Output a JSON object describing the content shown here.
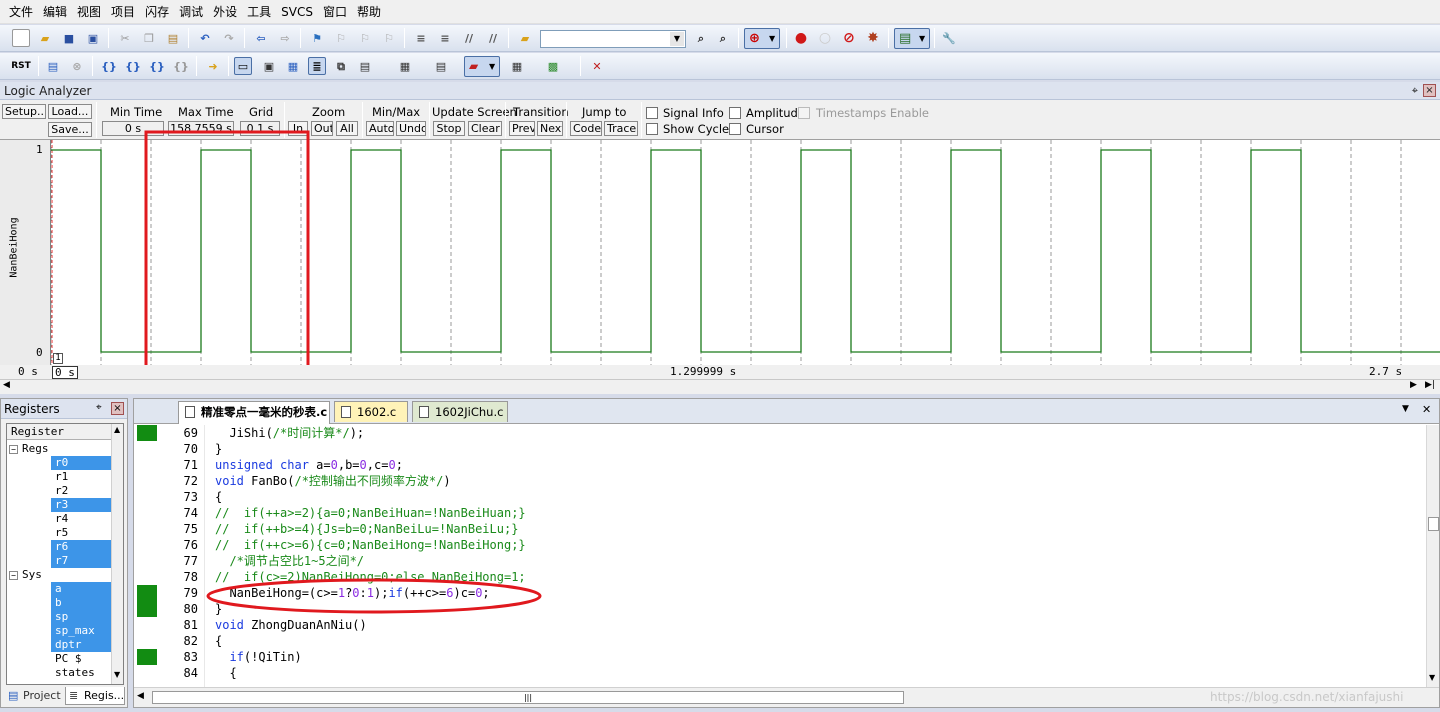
{
  "menu": [
    "文件",
    "编辑",
    "视图",
    "项目",
    "闪存",
    "调试",
    "外设",
    "工具",
    "SVCS",
    "窗口",
    "帮助"
  ],
  "toolbar1": {
    "combo_value": ""
  },
  "toolbar2": {
    "rst_label": "RST"
  },
  "logic_analyzer": {
    "title": "Logic Analyzer",
    "pin_label": "⌖",
    "close_label": "×",
    "setup_label": "Setup...",
    "load_label": "Load...",
    "save_label": "Save...",
    "min_time_label": "Min Time",
    "min_time_value": "0 s",
    "max_time_label": "Max Time",
    "max_time_value": "158.7559 s",
    "grid_label": "Grid",
    "grid_value": "0.1 s",
    "zoom_label": "Zoom",
    "zoom_in": "In",
    "zoom_out": "Out",
    "zoom_all": "All",
    "minmax_label": "Min/Max",
    "minmax_auto": "Auto",
    "minmax_undo": "Undo",
    "update_label": "Update Screen",
    "update_stop": "Stop",
    "update_clear": "Clear",
    "transition_label": "Transition",
    "transition_prev": "Prev",
    "transition_next": "Next",
    "jump_label": "Jump to",
    "jump_code": "Code",
    "jump_trace": "Trace",
    "signal_info": "Signal Info",
    "amplitude": "Amplitude",
    "timestamps": "Timestamps Enable",
    "show_cycles": "Show Cycles",
    "cursor": "Cursor",
    "signal_name": "NanBeiHong",
    "y_high": "1",
    "y_low": "0",
    "marker": "1",
    "time_start": "0 s",
    "time_cursor": "0 s",
    "time_mid": "1.299999 s",
    "time_end": "2.7 s",
    "colors": {
      "wave": "#1a7a1a",
      "grid": "#808080",
      "highlight_box": "#e0191e"
    },
    "waveform": {
      "t_range_s": [
        0,
        2.7
      ],
      "rises_s": [
        0.0,
        0.3,
        0.6,
        0.9,
        1.2,
        1.5,
        1.8,
        2.1,
        2.4
      ],
      "high_duration_s": 0.1
    }
  },
  "registers": {
    "title": "Registers",
    "header": "Register",
    "groups": [
      {
        "name": "Regs",
        "items": [
          {
            "name": "r0",
            "hl": true
          },
          {
            "name": "r1",
            "hl": false
          },
          {
            "name": "r2",
            "hl": false
          },
          {
            "name": "r3",
            "hl": true
          },
          {
            "name": "r4",
            "hl": false
          },
          {
            "name": "r5",
            "hl": false
          },
          {
            "name": "r6",
            "hl": true
          },
          {
            "name": "r7",
            "hl": true
          }
        ]
      },
      {
        "name": "Sys",
        "items": [
          {
            "name": "a",
            "hl": true
          },
          {
            "name": "b",
            "hl": true
          },
          {
            "name": "sp",
            "hl": true
          },
          {
            "name": "sp_max",
            "hl": true
          },
          {
            "name": "dptr",
            "hl": true
          },
          {
            "name": "PC  $",
            "hl": false
          },
          {
            "name": "states",
            "hl": false
          }
        ]
      }
    ],
    "tab_project": "Project",
    "tab_regs": "Regis..."
  },
  "editor": {
    "tabs": [
      {
        "label": "精准零点一毫米的秒表.c",
        "active": true
      },
      {
        "label": "1602.c",
        "active": false
      },
      {
        "label": "1602JiChu.c",
        "active": false
      }
    ],
    "lines": [
      {
        "num": "69",
        "text": "  JiShi(/*时间计算*/);",
        "bp": true
      },
      {
        "num": "70",
        "text": "}",
        "bp": false
      },
      {
        "num": "71",
        "text": "unsigned char a=0,b=0,c=0;",
        "bp": false
      },
      {
        "num": "72",
        "text": "void FanBo(/*控制输出不同频率方波*/)",
        "bp": false
      },
      {
        "num": "73",
        "text": "{",
        "bp": false
      },
      {
        "num": "74",
        "text": "//  if(++a>=2){a=0;NanBeiHuan=!NanBeiHuan;}",
        "bp": false
      },
      {
        "num": "75",
        "text": "//  if(++b>=4){Js=b=0;NanBeiLu=!NanBeiLu;}",
        "bp": false
      },
      {
        "num": "76",
        "text": "//  if(++c>=6){c=0;NanBeiHong=!NanBeiHong;}",
        "bp": false
      },
      {
        "num": "77",
        "text": "  /*调节占空比1~5之间*/",
        "bp": false
      },
      {
        "num": "78",
        "text": "//  if(c>=2)NanBeiHong=0;else NanBeiHong=1;",
        "bp": false
      },
      {
        "num": "79",
        "text": "  NanBeiHong=(c>=1?0:1);if(++c>=6)c=0;",
        "bp": true
      },
      {
        "num": "80",
        "text": "}",
        "bp": true
      },
      {
        "num": "81",
        "text": "void ZhongDuanAnNiu()",
        "bp": false
      },
      {
        "num": "82",
        "text": "{",
        "bp": false
      },
      {
        "num": "83",
        "text": "  if(!QiTin)",
        "bp": true
      },
      {
        "num": "84",
        "text": "  {",
        "bp": false
      }
    ],
    "watermark": "https://blog.csdn.net/xianfajushi"
  }
}
